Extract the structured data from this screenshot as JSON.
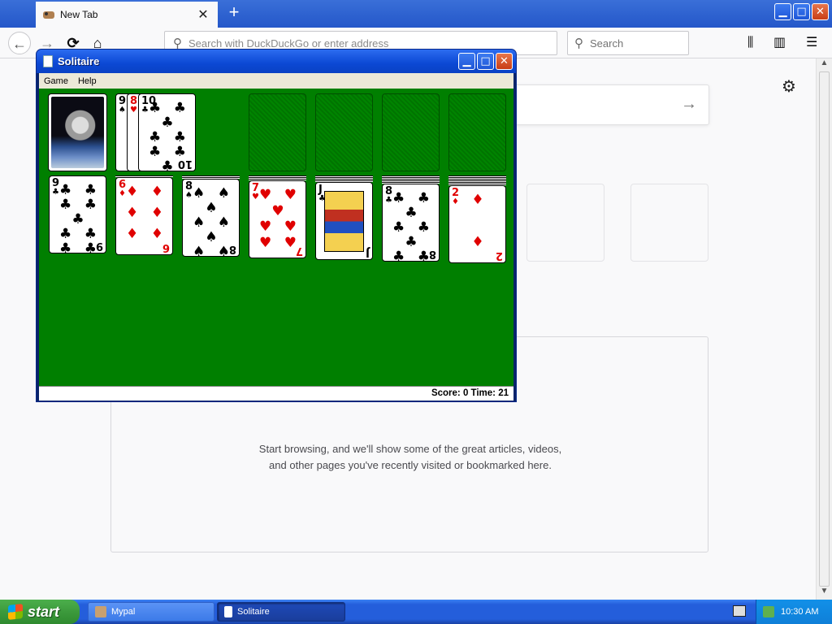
{
  "browser": {
    "tab_title": "New Tab",
    "new_tab_symbol": "+",
    "url_placeholder": "Search with DuckDuckGo or enter address",
    "search_placeholder": "Search",
    "highlights_message": "Start browsing, and we'll show some of the great articles, videos, and other pages you've recently visited or bookmarked here."
  },
  "solitaire": {
    "title": "Solitaire",
    "menu": [
      "Game",
      "Help"
    ],
    "status": "Score: 0 Time: 21",
    "waste": [
      {
        "rank": "9",
        "suit": "♠",
        "color": "blk"
      },
      {
        "rank": "8",
        "suit": "♥",
        "color": "red"
      },
      {
        "rank": "10",
        "suit": "♣",
        "color": "blk"
      }
    ],
    "tableau": [
      {
        "rank": "9",
        "suit": "♣",
        "color": "blk",
        "hidden": 0
      },
      {
        "rank": "6",
        "suit": "♦",
        "color": "red",
        "hidden": 1
      },
      {
        "rank": "8",
        "suit": "♠",
        "color": "blk",
        "hidden": 2
      },
      {
        "rank": "7",
        "suit": "♥",
        "color": "red",
        "hidden": 3
      },
      {
        "rank": "J",
        "suit": "♣",
        "color": "blk",
        "hidden": 4
      },
      {
        "rank": "8",
        "suit": "♣",
        "color": "blk",
        "hidden": 5
      },
      {
        "rank": "2",
        "suit": "♦",
        "color": "red",
        "hidden": 6
      }
    ]
  },
  "taskbar": {
    "start_label": "start",
    "tasks": [
      "Mypal",
      "Solitaire"
    ],
    "clock": "10:30 AM"
  },
  "icons": {
    "back": "←",
    "forward": "→",
    "reload": "⟳",
    "home": "⌂",
    "search": "⚲",
    "library": "⫼",
    "sidebar": "▥",
    "menu": "☰",
    "gear": "⚙",
    "go": "→",
    "close": "✕",
    "minimize": "▁",
    "maximize": "□"
  }
}
